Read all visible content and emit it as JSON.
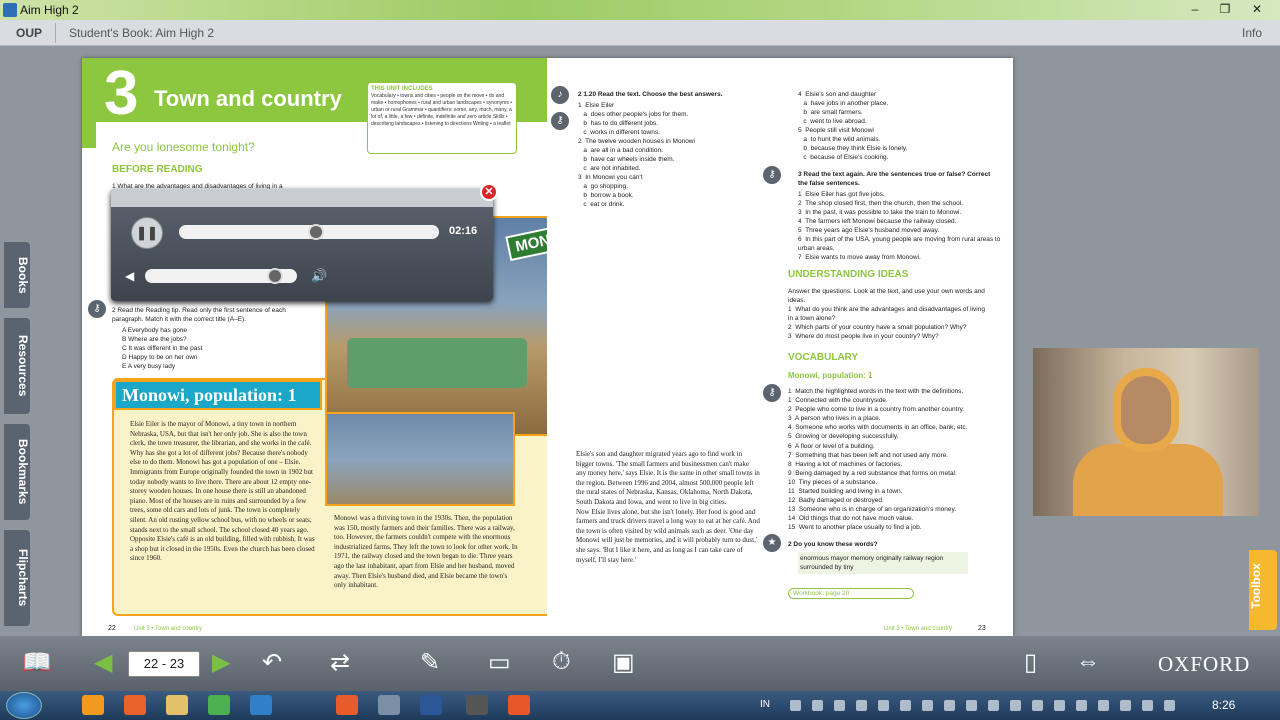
{
  "window": {
    "title": "Aim High 2",
    "controls": [
      "–",
      "❐",
      "✕"
    ]
  },
  "menubar": {
    "publisher": "OUP",
    "book_title": "Student's Book: Aim High 2",
    "info": "Info"
  },
  "side_tabs": [
    "Books",
    "Resources",
    "Bookmarks",
    "Flipcharts"
  ],
  "left_page": {
    "unit_number": "3",
    "unit_title": "Town and country",
    "unit_box_heading": "THIS UNIT INCLUDES",
    "unit_box_text": "Vocabulary • towns and cities • people on the move • do and make • homophones • rural and urban landscapes • synonyms • urban or rural  Grammar • quantifiers: some, any, much, many, a lot of, a little, a few • definite, indefinite and zero article  Skills • describing landscapes • listening to directions  Writing • a leaflet",
    "subtitle": "Are you lonesome tonight?",
    "before_reading": "BEFORE READING",
    "q1": "1  What are the advantages and disadvantages of living in a",
    "reading_tip_q": "2  Read the Reading tip. Read only the first sentence of each paragraph. Match it with the correct title (A–E).",
    "options": [
      "A  Everybody has gone",
      "B  Where are the jobs?",
      "C  It was different in the past",
      "D  Happy to be on her own",
      "E  A very busy lady"
    ],
    "banner": "Monowi, population: 1",
    "sign": "MONOWI",
    "story_col1": "Elsie Eiler is the mayor of Monowi, a tiny town in northern Nebraska, USA, but that isn't her only job. She is also the town clerk, the town treasurer, the librarian, and she works in the café. Why has she got a lot of different jobs? Because there's nobody else to do them. Monowi has got a population of one – Elsie.\nImmigrants from Europe originally founded the town in 1902 but today nobody wants to live there. There are about 12 empty one-storey wooden houses. In one house there is still an abandoned piano. Most of the houses are in ruins and surrounded by a few trees, some old cars and lots of junk. The town is completely silent. An old rusting yellow school bus, with no wheels or seats, stands next to the small school. The school closed 40 years ago. Opposite Elsie's café is an old building, filled with rubbish. It was a shop but it closed in the 1950s. Even the church has been closed since 1960.",
    "story_col2": "Monowi was a thriving town in the 1930s. Then, the population was 150, mostly farmers and their families. There was a railway, too. However, the farmers couldn't compete with the enormous industrialized farms. They left the town to look for other work. In 1971, the railway closed and the town began to die. Three years ago the last inhabitant, apart from Elsie and her husband, moved away. Then Elsie's husband died, and Elsie became the town's only inhabitant.",
    "story_col3": "Elsie's son and daughter migrated years ago to find work in bigger towns. 'The small farmers and businessmen can't make any money here,' says Elsie. It is the same in other small towns in the region. Between 1996 and 2004, almost 500,000 people left the rural states of Nebraska, Kansas, Oklahoma, North Dakota, South Dakota and Iowa, and went to live in big cities.\nNow Elsie lives alone, but she isn't lonely. Her food is good and farmers and truck drivers travel a long way to eat at her café. And the town is often visited by wild animals such as deer. 'One day Monowi will just be memories, and it will probably turn to dust,' she says. 'But I like it here, and as long as I can take care of myself, I'll stay here.'",
    "foot": "Unit 3 • Town and country",
    "page": "22"
  },
  "right_page": {
    "ex2": "2  1.20  Read the text. Choose the best answers.",
    "ex2_items": "1  Elsie Eiler\n   a  does other people's jobs for them.\n   b  has to do different jobs.\n   c  works in different towns.\n2  The twelve wooden houses in Monowi\n   a  are all in a bad condition.\n   b  have car wheels inside them.\n   c  are not inhabited.\n3  In Monowi you can't\n   a  go shopping.\n   b  borrow a book.\n   c  eat or drink.",
    "ex2_col2": "4  Elsie's son and daughter\n   a  have jobs in another place.\n   b  are small farmers.\n   c  went to live abroad.\n5  People still visit Monowi\n   a  to hunt the wild animals.\n   b  because they think Elsie is lonely.\n   c  because of Elsie's cooking.",
    "ex3": "3  Read the text again. Are the sentences true or false? Correct the false sentences.",
    "ex3_items": "1  Elsie Eiler has got five jobs.\n2  The shop closed first, then the church, then the school.\n3  In the past, it was possible to take the train to Monowi.\n4  The farmers left Monowi because the railway closed.\n5  Three years ago Elsie's husband moved away.\n6  In this part of the USA, young people are moving from rural areas to urban areas.\n7  Elsie wants to move away from Monowi.",
    "understanding": "UNDERSTANDING IDEAS",
    "understanding_q": "Answer the questions. Look at the text, and use your own words and ideas.\n1  What do you think are the advantages and disadvantages of living in a town alone?\n2  Which parts of your country have a small population? Why?\n3  Where do most people live in your country? Why?",
    "vocab": "VOCABULARY",
    "vocab_sub": "Monowi, population: 1",
    "vocab_q": "1  Match the highlighted words in the text with the definitions.\n1  Connected with the countryside.\n2  People who come to live in a country from another country.\n3  A person who lives in a place.\n4  Someone who works with documents in an office, bank, etc.\n5  Growing or developing successfully.\n6  A floor or level of a building.\n7  Something that has been left and not used any more.\n8  Having a lot of machines or factories.\n9  Being damaged by a red substance that forms on metal.\n10  Tiny pieces of a substance.\n11  Started building and living in a town.\n12  Badly damaged or destroyed.\n13  Someone who is in charge of an organization's money.\n14  Old things that do not have much value.\n15  Went to another place usually to find a job.",
    "vocab_q2": "2  Do you know these words?",
    "vocab_words": "enormous   mayor   memory   originally   railway   region   surrounded by   tiny",
    "workbook": "Workbook: page 20",
    "foot": "Unit 3 • Town and country",
    "page": "23"
  },
  "audio_player": {
    "time": "02:16",
    "progress": 0.53,
    "volume": 0.9,
    "pause_symbol": "❚❚",
    "close_symbol": "✕",
    "mute_symbol": "◀",
    "loud_symbol": "🔊"
  },
  "toolbox": "Toolbox",
  "bottom_bar": {
    "page_range": "22 - 23",
    "brand": "OXFORD"
  },
  "taskbar": {
    "lang": "IN",
    "clock": "8:26"
  }
}
